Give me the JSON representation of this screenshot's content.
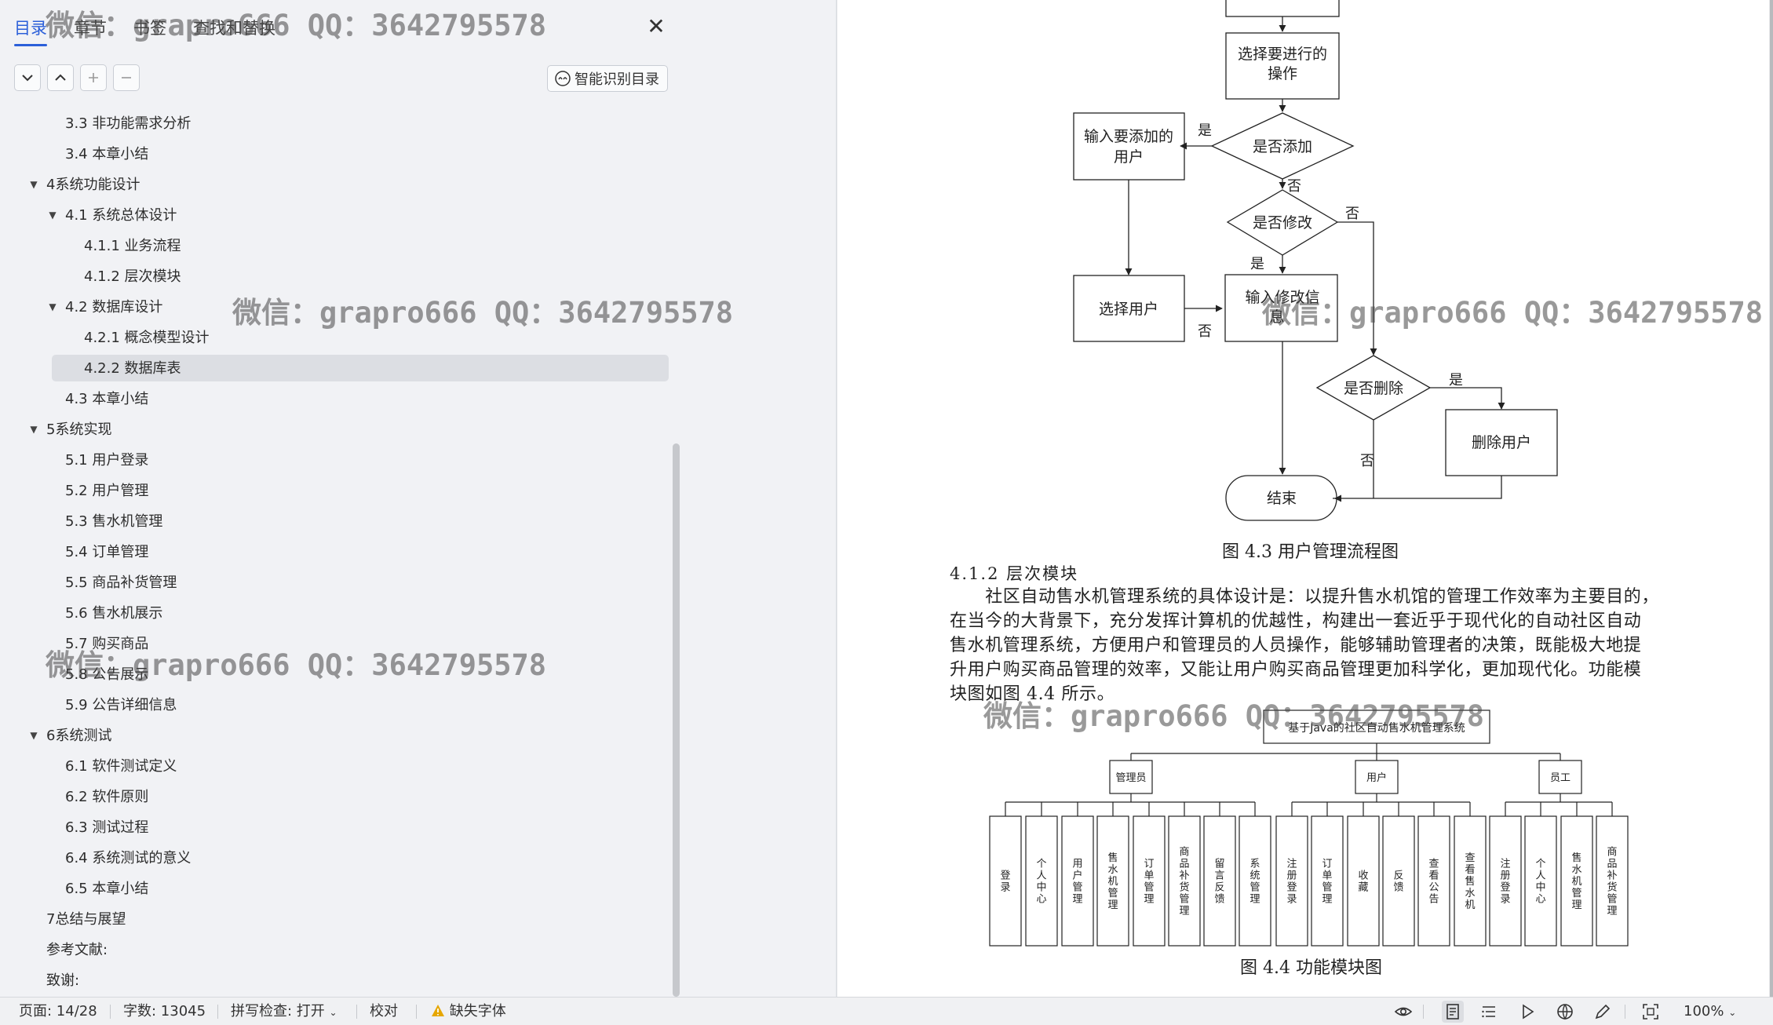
{
  "nav": {
    "tabs": [
      {
        "label": "目录"
      },
      {
        "label": "章节"
      },
      {
        "label": "书签"
      },
      {
        "label": "查找和替换"
      }
    ],
    "close_glyph": "✕",
    "smart_toc_label": "智能识别目录",
    "toolbar_icons": [
      "chevron-down-icon",
      "chevron-up-icon",
      "plus-icon",
      "minus-icon"
    ],
    "toc": [
      {
        "label": "3.3  非功能需求分析",
        "level": 2,
        "caret": ""
      },
      {
        "label": "3.4  本章小结",
        "level": 2,
        "caret": ""
      },
      {
        "label": "4系统功能设计",
        "level": 1,
        "caret": "▼"
      },
      {
        "label": "4.1  系统总体设计",
        "level": 2,
        "caret": "▼"
      },
      {
        "label": "4.1.1  业务流程",
        "level": 3,
        "caret": ""
      },
      {
        "label": "4.1.2  层次模块",
        "level": 3,
        "caret": ""
      },
      {
        "label": "4.2  数据库设计",
        "level": 2,
        "caret": "▼"
      },
      {
        "label": "4.2.1  概念模型设计",
        "level": 3,
        "caret": ""
      },
      {
        "label": "4.2.2  数据库表",
        "level": 3,
        "caret": "",
        "selected": true
      },
      {
        "label": "4.3  本章小结",
        "level": 2,
        "caret": ""
      },
      {
        "label": "5系统实现",
        "level": 1,
        "caret": "▼"
      },
      {
        "label": "5.1  用户登录",
        "level": 2,
        "caret": ""
      },
      {
        "label": "5.2  用户管理",
        "level": 2,
        "caret": ""
      },
      {
        "label": "5.3  售水机管理",
        "level": 2,
        "caret": ""
      },
      {
        "label": "5.4  订单管理",
        "level": 2,
        "caret": ""
      },
      {
        "label": "5.5  商品补货管理",
        "level": 2,
        "caret": ""
      },
      {
        "label": "5.6  售水机展示",
        "level": 2,
        "caret": ""
      },
      {
        "label": "5.7  购买商品",
        "level": 2,
        "caret": ""
      },
      {
        "label": "5.8  公告展示",
        "level": 2,
        "caret": ""
      },
      {
        "label": "5.9  公告详细信息",
        "level": 2,
        "caret": ""
      },
      {
        "label": "6系统测试",
        "level": 1,
        "caret": "▼"
      },
      {
        "label": "6.1  软件测试定义",
        "level": 2,
        "caret": ""
      },
      {
        "label": "6.2  软件原则",
        "level": 2,
        "caret": ""
      },
      {
        "label": "6.3  测试过程",
        "level": 2,
        "caret": ""
      },
      {
        "label": "6.4  系统测试的意义",
        "level": 2,
        "caret": ""
      },
      {
        "label": "6.5  本章小结",
        "level": 2,
        "caret": ""
      },
      {
        "label": "7总结与展望",
        "level": 1,
        "caret": ""
      },
      {
        "label": "参考文献:",
        "level": 1,
        "caret": ""
      },
      {
        "label": "致谢:",
        "level": 1,
        "caret": ""
      }
    ]
  },
  "doc": {
    "flowchart": {
      "select_op": [
        "选择要进行的",
        "操作"
      ],
      "is_add": "是否添加",
      "input_add_user": [
        "输入要添加的",
        "用户"
      ],
      "is_modify": "是否修改",
      "select_user": "选择用户",
      "input_modify_info": [
        "输入修改信",
        "息"
      ],
      "is_delete": "是否删除",
      "delete_user": "删除用户",
      "end": "结束",
      "yes": "是",
      "no": "否"
    },
    "fig43_caption": "图 4.3  用户管理流程图",
    "section_heading": "4.1.2   层次模块",
    "paragraph_lines": [
      "　　社区自动售水机管理系统的具体设计是：以提升售水机馆的管理工作效率为主要目的，",
      "在当今的大背景下，充分发挥计算机的优越性，构建出一套近乎于现代化的自动社区自动",
      "售水机管理系统，方便用户和管理员的人员操作，能够辅助管理者的决策，既能极大地提",
      "升用户购买商品管理的效率，又能让用户购买商品管理更加科学化，更加现代化。功能模",
      "块图如图 4.4 所示。"
    ],
    "module_diagram": {
      "root": "基于Java的社区自动售水机管理系统",
      "groups": [
        {
          "name": "管理员",
          "children": [
            "登录",
            "个人中心",
            "用户管理",
            "售水机管理",
            "订单管理",
            "商品补货管理",
            "留言反馈",
            "系统管理"
          ]
        },
        {
          "name": "用户",
          "children": [
            "注册登录",
            "订单管理",
            "收藏",
            "反馈",
            "查看公告",
            "查看售水机"
          ]
        },
        {
          "name": "员工",
          "children": [
            "注册登录",
            "个人中心",
            "售水机管理",
            "商品补货管理"
          ]
        }
      ]
    },
    "fig44_caption": "图 4.4  功能模块图"
  },
  "status": {
    "page": "页面: 14/28",
    "words": "字数: 13045",
    "spell": "拼写检查: 打开",
    "proof": "校对",
    "missing_font": "缺失字体",
    "zoom": "100%",
    "icons": [
      "eye-icon",
      "page-view-icon",
      "outline-view-icon",
      "play-icon",
      "globe-icon",
      "pen-icon",
      "fit-icon"
    ]
  },
  "watermark": "微信：grapro666 QQ：3642795578",
  "colors": {
    "accent": "#2b5fd9",
    "nav_bg": "#f1f2f5",
    "selected_bg": "#dcdee3",
    "warning": "#e6a700"
  }
}
